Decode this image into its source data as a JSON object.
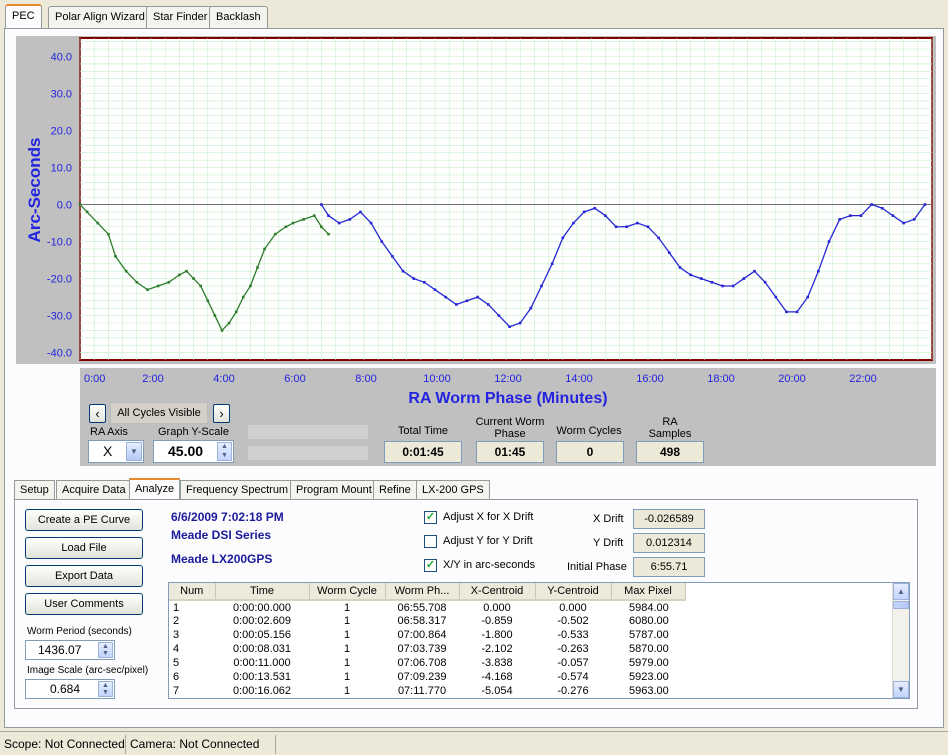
{
  "tabs": [
    {
      "label": "PEC",
      "active": true
    },
    {
      "label": "Polar Align Wizard",
      "active": false
    },
    {
      "label": "Star Finder",
      "active": false
    },
    {
      "label": "Backlash",
      "active": false
    }
  ],
  "chart_data": {
    "type": "line",
    "ylabel": "Arc-Seconds",
    "xlabel": "RA Worm Phase (Minutes)",
    "xlim": [
      0,
      24
    ],
    "ylim": [
      -42,
      45
    ],
    "yticks": [
      "40.0",
      "30.0",
      "20.0",
      "10.0",
      "0.0",
      "-10.0",
      "-20.0",
      "-30.0",
      "-40.0"
    ],
    "ytick_values": [
      40,
      30,
      20,
      10,
      0,
      -10,
      -20,
      -30,
      -40
    ],
    "xticks": [
      "0:00",
      "2:00",
      "4:00",
      "6:00",
      "8:00",
      "10:00",
      "12:00",
      "14:00",
      "16:00",
      "18:00",
      "20:00",
      "22:00"
    ],
    "xtick_values": [
      0,
      2,
      4,
      6,
      8,
      10,
      12,
      14,
      16,
      18,
      20,
      22
    ],
    "grid": true,
    "series": [
      {
        "color": "#2e7d2e",
        "x": [
          0,
          0.2,
          0.5,
          0.8,
          1.0,
          1.3,
          1.6,
          1.9,
          2.2,
          2.5,
          2.8,
          3.0,
          3.2,
          3.4,
          3.6,
          3.8,
          4.0,
          4.2,
          4.4,
          4.6,
          4.8,
          5.0,
          5.2,
          5.5,
          5.8,
          6.0,
          6.3,
          6.6,
          6.8,
          7.0
        ],
        "y": [
          0,
          -2,
          -5,
          -8,
          -14,
          -18,
          -21,
          -23,
          -22,
          -21,
          -19,
          -18,
          -20,
          -22,
          -26,
          -30,
          -34,
          -32,
          -29,
          -25,
          -22,
          -17,
          -12,
          -8,
          -6,
          -5,
          -4,
          -3,
          -6,
          -8
        ]
      },
      {
        "color": "#2525d6",
        "x": [
          6.8,
          7.0,
          7.3,
          7.6,
          7.9,
          8.2,
          8.5,
          8.8,
          9.1,
          9.4,
          9.7,
          10.0,
          10.3,
          10.6,
          10.9,
          11.2,
          11.5,
          11.8,
          12.1,
          12.4,
          12.7,
          13.0,
          13.3,
          13.6,
          13.9,
          14.2,
          14.5,
          14.8,
          15.1,
          15.4,
          15.7,
          16.0,
          16.3,
          16.6,
          16.9,
          17.2,
          17.5,
          17.8,
          18.1,
          18.4,
          18.7,
          19.0,
          19.3,
          19.6,
          19.9,
          20.2,
          20.5,
          20.8,
          21.1,
          21.4,
          21.7,
          22.0,
          22.3,
          22.6,
          22.9,
          23.2,
          23.5,
          23.8
        ],
        "y": [
          0,
          -3,
          -5,
          -4,
          -2,
          -5,
          -10,
          -14,
          -18,
          -20,
          -21,
          -23,
          -25,
          -27,
          -26,
          -25,
          -27,
          -30,
          -33,
          -32,
          -28,
          -22,
          -16,
          -9,
          -5,
          -2,
          -1,
          -3,
          -6,
          -6,
          -5,
          -6,
          -9,
          -13,
          -17,
          -19,
          -20,
          -21,
          -22,
          -22,
          -20,
          -18,
          -21,
          -25,
          -29,
          -29,
          -25,
          -18,
          -10,
          -4,
          -3,
          -3,
          0,
          -1,
          -3,
          -5,
          -4,
          0
        ]
      }
    ]
  },
  "graph_controls": {
    "prev_glyph": "‹",
    "next_glyph": "›",
    "cycles_label": "All Cycles Visible",
    "ra_axis_label": "RA Axis",
    "ra_axis_value": "X",
    "yscale_label": "Graph Y-Scale",
    "yscale_value": "45.00"
  },
  "stats": [
    {
      "label": "Total Time",
      "value": "0:01:45"
    },
    {
      "label": "Current Worm Phase",
      "value": "01:45"
    },
    {
      "label": "Worm Cycles",
      "value": "0"
    },
    {
      "label": "RA Samples",
      "value": "498"
    }
  ],
  "subtabs": [
    {
      "label": "Setup",
      "active": false
    },
    {
      "label": "Acquire Data",
      "active": false
    },
    {
      "label": "Analyze",
      "active": true
    },
    {
      "label": "Frequency Spectrum",
      "active": false
    },
    {
      "label": "Program Mount",
      "active": false
    },
    {
      "label": "Refine",
      "active": false
    },
    {
      "label": "LX-200 GPS",
      "active": false
    }
  ],
  "analyze": {
    "buttons": [
      "Create a PE Curve",
      "Load File",
      "Export Data",
      "User Comments"
    ],
    "worm_period_label": "Worm Period (seconds)",
    "worm_period_value": "1436.07",
    "image_scale_label": "Image Scale (arc-sec/pixel)",
    "image_scale_value": "0.684",
    "date": "6/6/2009 7:02:18 PM",
    "camera": "Meade DSI Series",
    "mount": "Meade LX200GPS",
    "checks": [
      {
        "label": "Adjust X for X Drift",
        "checked": true
      },
      {
        "label": "Adjust Y for Y Drift",
        "checked": false
      },
      {
        "label": "X/Y in arc-seconds",
        "checked": true
      }
    ],
    "x_drift_label": "X Drift",
    "x_drift_value": "-0.026589",
    "y_drift_label": "Y Drift",
    "y_drift_value": "0.012314",
    "initial_phase_label": "Initial Phase",
    "initial_phase_value": "6:55.71"
  },
  "table": {
    "columns": [
      "Num",
      "Time",
      "Worm Cycle",
      "Worm Ph...",
      "X-Centroid",
      "Y-Centroid",
      "Max Pixel"
    ],
    "rows": [
      [
        "1",
        "0:00:00.000",
        "1",
        "06:55.708",
        "0.000",
        "0.000",
        "5984.00"
      ],
      [
        "2",
        "0:00:02.609",
        "1",
        "06:58.317",
        "-0.859",
        "-0.502",
        "6080.00"
      ],
      [
        "3",
        "0:00:05.156",
        "1",
        "07:00.864",
        "-1.800",
        "-0.533",
        "5787.00"
      ],
      [
        "4",
        "0:00:08.031",
        "1",
        "07:03.739",
        "-2.102",
        "-0.263",
        "5870.00"
      ],
      [
        "5",
        "0:00:11.000",
        "1",
        "07:06.708",
        "-3.838",
        "-0.057",
        "5979.00"
      ],
      [
        "6",
        "0:00:13.531",
        "1",
        "07:09.239",
        "-4.168",
        "-0.574",
        "5923.00"
      ],
      [
        "7",
        "0:00:16.062",
        "1",
        "07:11.770",
        "-5.054",
        "-0.276",
        "5963.00"
      ]
    ]
  },
  "status": {
    "scope": "Scope: Not Connected",
    "camera": "Camera: Not Connected"
  }
}
